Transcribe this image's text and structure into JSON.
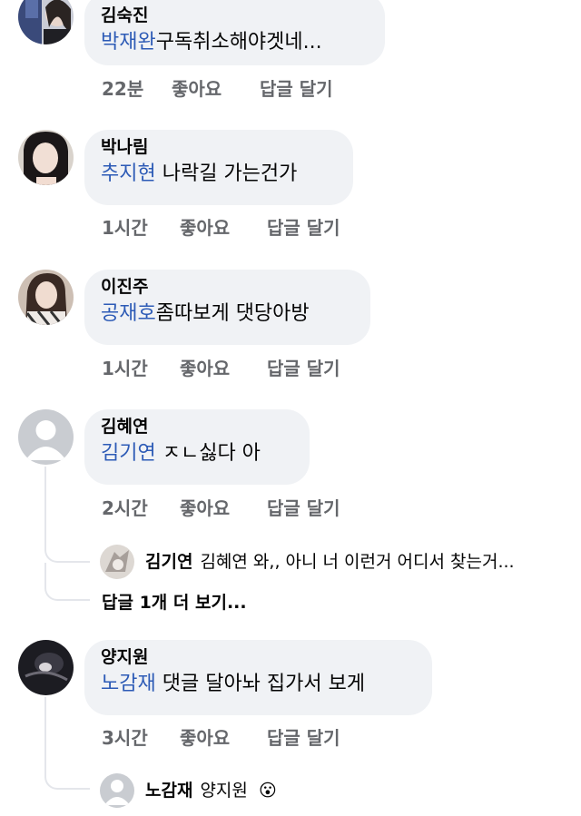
{
  "actions": {
    "like_label": "좋아요",
    "reply_label": "답글 달기"
  },
  "comments": [
    {
      "author": "김숙진",
      "mention": "박재완",
      "text": "구독취소해야겟네...",
      "time": "22분"
    },
    {
      "author": "박나림",
      "mention": "추지현",
      "text": " 나락길 가는건가",
      "time": "1시간"
    },
    {
      "author": "이진주",
      "mention": "공재호",
      "text": "좀따보게 댓당아방",
      "time": "1시간"
    },
    {
      "author": "김혜연",
      "mention": "김기연",
      "text": " ㅈㄴ싫다 아",
      "time": "2시간"
    },
    {
      "author": "양지원",
      "mention": "노감재",
      "text": " 댓글 달아놔 집가서 보게",
      "time": "3시간"
    }
  ],
  "replies": [
    {
      "author": "김기연",
      "text": "김혜연 와,, 아니 너 이런거 어디서 찾는거..."
    },
    {
      "author": "노감재",
      "text": "양지원"
    }
  ],
  "more_replies_label": "답글 1개 더 보기...",
  "reaction_emoji": "😮"
}
